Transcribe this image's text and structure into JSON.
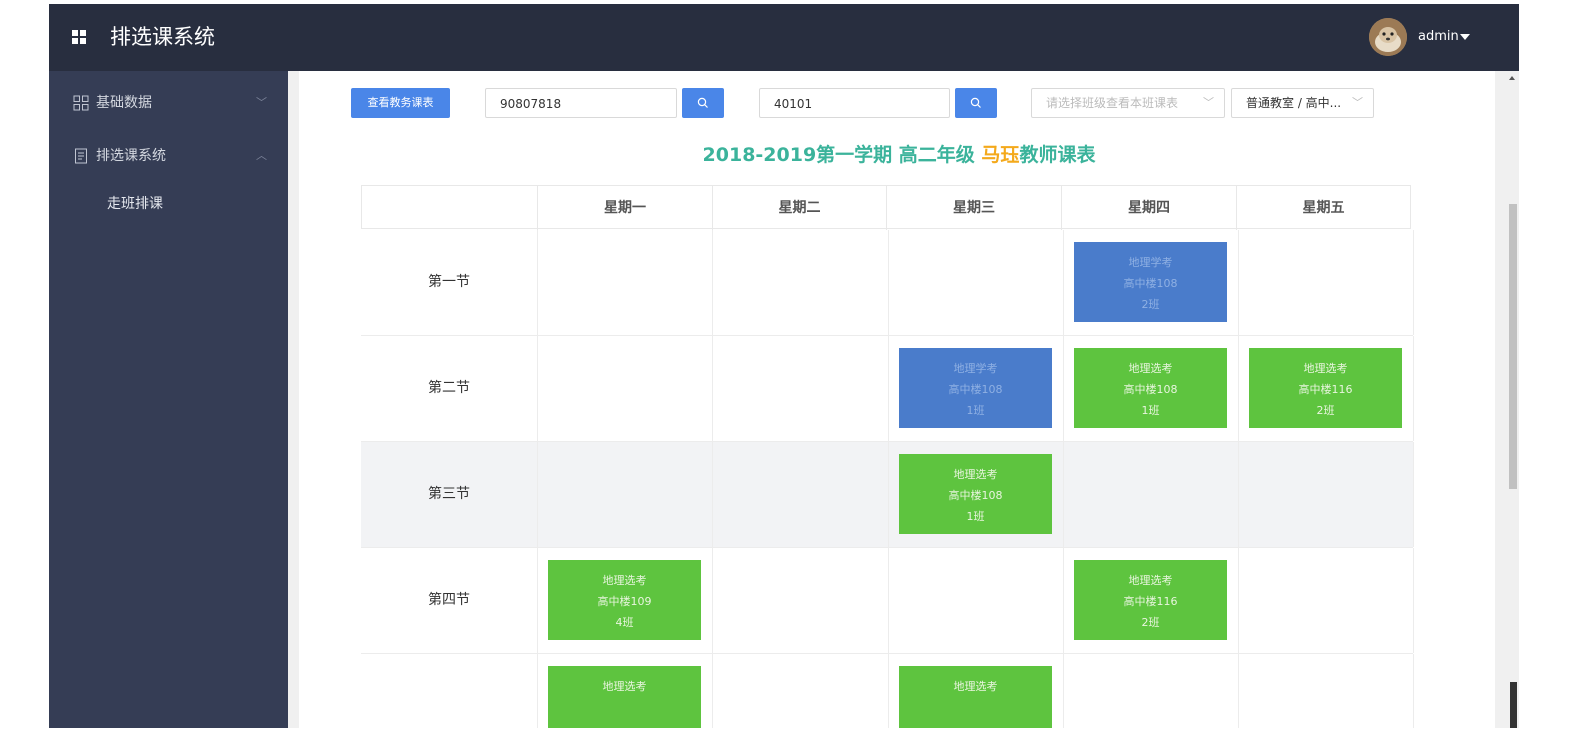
{
  "header": {
    "title": "排选课系统",
    "user_name": "admin"
  },
  "sidebar": {
    "items": [
      {
        "label": "基础数据",
        "icon": "grid-icon",
        "expanded": false
      },
      {
        "label": "排选课系统",
        "icon": "document-icon",
        "expanded": true
      }
    ],
    "subitems": [
      {
        "label": "走班排课"
      }
    ]
  },
  "toolbar": {
    "view_button_label": "查看教务课表",
    "teacher_input_value": "90807818",
    "room_input_value": "40101",
    "class_select_placeholder": "请选择班级查看本班课表",
    "room_select_value": "普通教室 / 高中..."
  },
  "timetable": {
    "title_prefix": "2018-2019第一学期 高二年级 ",
    "teacher_name": "马珏",
    "title_suffix": "教师课表",
    "days": [
      "星期一",
      "星期二",
      "星期三",
      "星期四",
      "星期五"
    ],
    "periods": [
      {
        "label": "第一节",
        "shaded": false,
        "cells": [
          null,
          null,
          null,
          {
            "subject": "地理学考",
            "room": "高中楼108",
            "class": "2班",
            "color": "blue"
          },
          null
        ]
      },
      {
        "label": "第二节",
        "shaded": false,
        "cells": [
          null,
          null,
          {
            "subject": "地理学考",
            "room": "高中楼108",
            "class": "1班",
            "color": "blue"
          },
          {
            "subject": "地理选考",
            "room": "高中楼108",
            "class": "1班",
            "color": "green"
          },
          {
            "subject": "地理选考",
            "room": "高中楼116",
            "class": "2班",
            "color": "green"
          }
        ]
      },
      {
        "label": "第三节",
        "shaded": true,
        "cells": [
          null,
          null,
          {
            "subject": "地理选考",
            "room": "高中楼108",
            "class": "1班",
            "color": "green"
          },
          null,
          null
        ]
      },
      {
        "label": "第四节",
        "shaded": false,
        "cells": [
          {
            "subject": "地理选考",
            "room": "高中楼109",
            "class": "4班",
            "color": "green"
          },
          null,
          null,
          {
            "subject": "地理选考",
            "room": "高中楼116",
            "class": "2班",
            "color": "green"
          },
          null
        ]
      },
      {
        "label": "",
        "shaded": false,
        "cells": [
          {
            "subject": "地理选考",
            "room": "",
            "class": "",
            "color": "green"
          },
          null,
          {
            "subject": "地理选考",
            "room": "",
            "class": "",
            "color": "green"
          },
          null,
          null
        ]
      }
    ]
  },
  "colors": {
    "topbar": "#282e3f",
    "sidebar": "#353d55",
    "accent_blue": "#4a86e8",
    "course_blue": "#4a7ccb",
    "course_green": "#5ec43f",
    "title_green": "#3bb39b",
    "title_orange": "#f4a91b"
  }
}
